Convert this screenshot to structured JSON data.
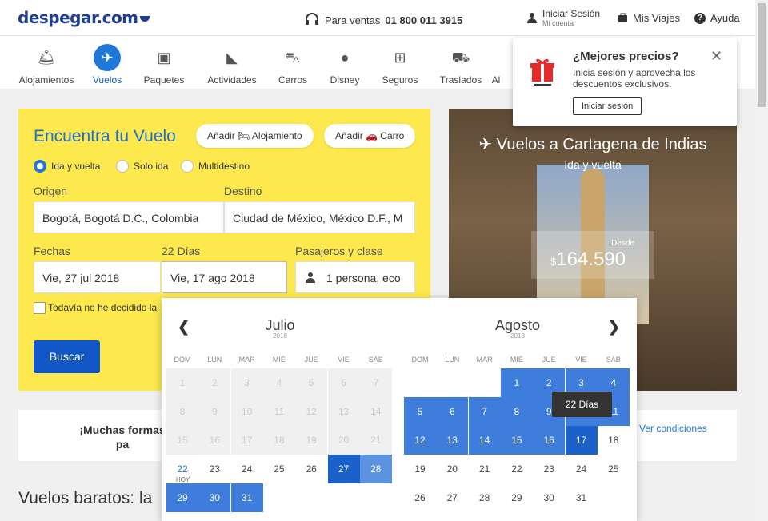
{
  "header": {
    "logo": "despegar.com",
    "phone_label": "Para ventas",
    "phone_number": "01 800 011 3915",
    "login": "Iniciar Sesión",
    "login_sub": "Mi cuenta",
    "trips": "Mis Viajes",
    "help": "Ayuda"
  },
  "nav": [
    {
      "label": "Alojamientos",
      "icon": "bell-icon"
    },
    {
      "label": "Vuelos",
      "icon": "plane-icon"
    },
    {
      "label": "Paquetes",
      "icon": "suitcase-icon"
    },
    {
      "label": "Actividades",
      "icon": "ticket-icon"
    },
    {
      "label": "Carros",
      "icon": "car-icon"
    },
    {
      "label": "Disney",
      "icon": "mickey-icon"
    },
    {
      "label": "Seguros",
      "icon": "medkit-icon"
    },
    {
      "label": "Traslados",
      "icon": "bus-icon"
    },
    {
      "label": "Al",
      "icon": "more-icon"
    }
  ],
  "search": {
    "title": "Encuentra tu Vuelo",
    "add_hotel": "Añadir 🛏 Alojamiento",
    "add_car": "Añadir 🚗 Carro",
    "trip_types": [
      "Ida y vuelta",
      "Solo ida",
      "Multidestino"
    ],
    "origin_label": "Origen",
    "origin_value": "Bogotá, Bogotá D.C., Colombia",
    "dest_label": "Destino",
    "dest_value": "Ciudad de México, México D.F., M",
    "dates_label": "Fechas",
    "days_label": "22 Días",
    "depart_value": "Vie, 27 jul 2018",
    "return_value": "Vie, 17 ago 2018",
    "pax_label": "Pasajeros y clase",
    "pax_value": "1 persona, eco",
    "undecided": "Todavía no he decidido la",
    "button": "Buscar"
  },
  "promo": {
    "title": "Vuelos a Cartagena de Indias",
    "subtitle": "Ida y vuelta",
    "desde": "Desde",
    "currency": "$",
    "price": "164.590"
  },
  "popup": {
    "title": "¿Mejores precios?",
    "text": "Inicia sesión y aprovecha los descuentos exclusivos.",
    "button": "Iniciar sesión"
  },
  "banner": {
    "text": "¡Muchas formas pa",
    "link": "Ver condiciones"
  },
  "cheap_title": "Vuelos baratos: la",
  "calendar": {
    "weekdays": [
      "DOM",
      "LUN",
      "MAR",
      "MIÉ",
      "JUE",
      "VIE",
      "SÁB"
    ],
    "left": {
      "month": "Julio",
      "year": "2018"
    },
    "right": {
      "month": "Agosto",
      "year": "2018"
    },
    "today_label": "HOY",
    "tooltip": "22 Días"
  }
}
